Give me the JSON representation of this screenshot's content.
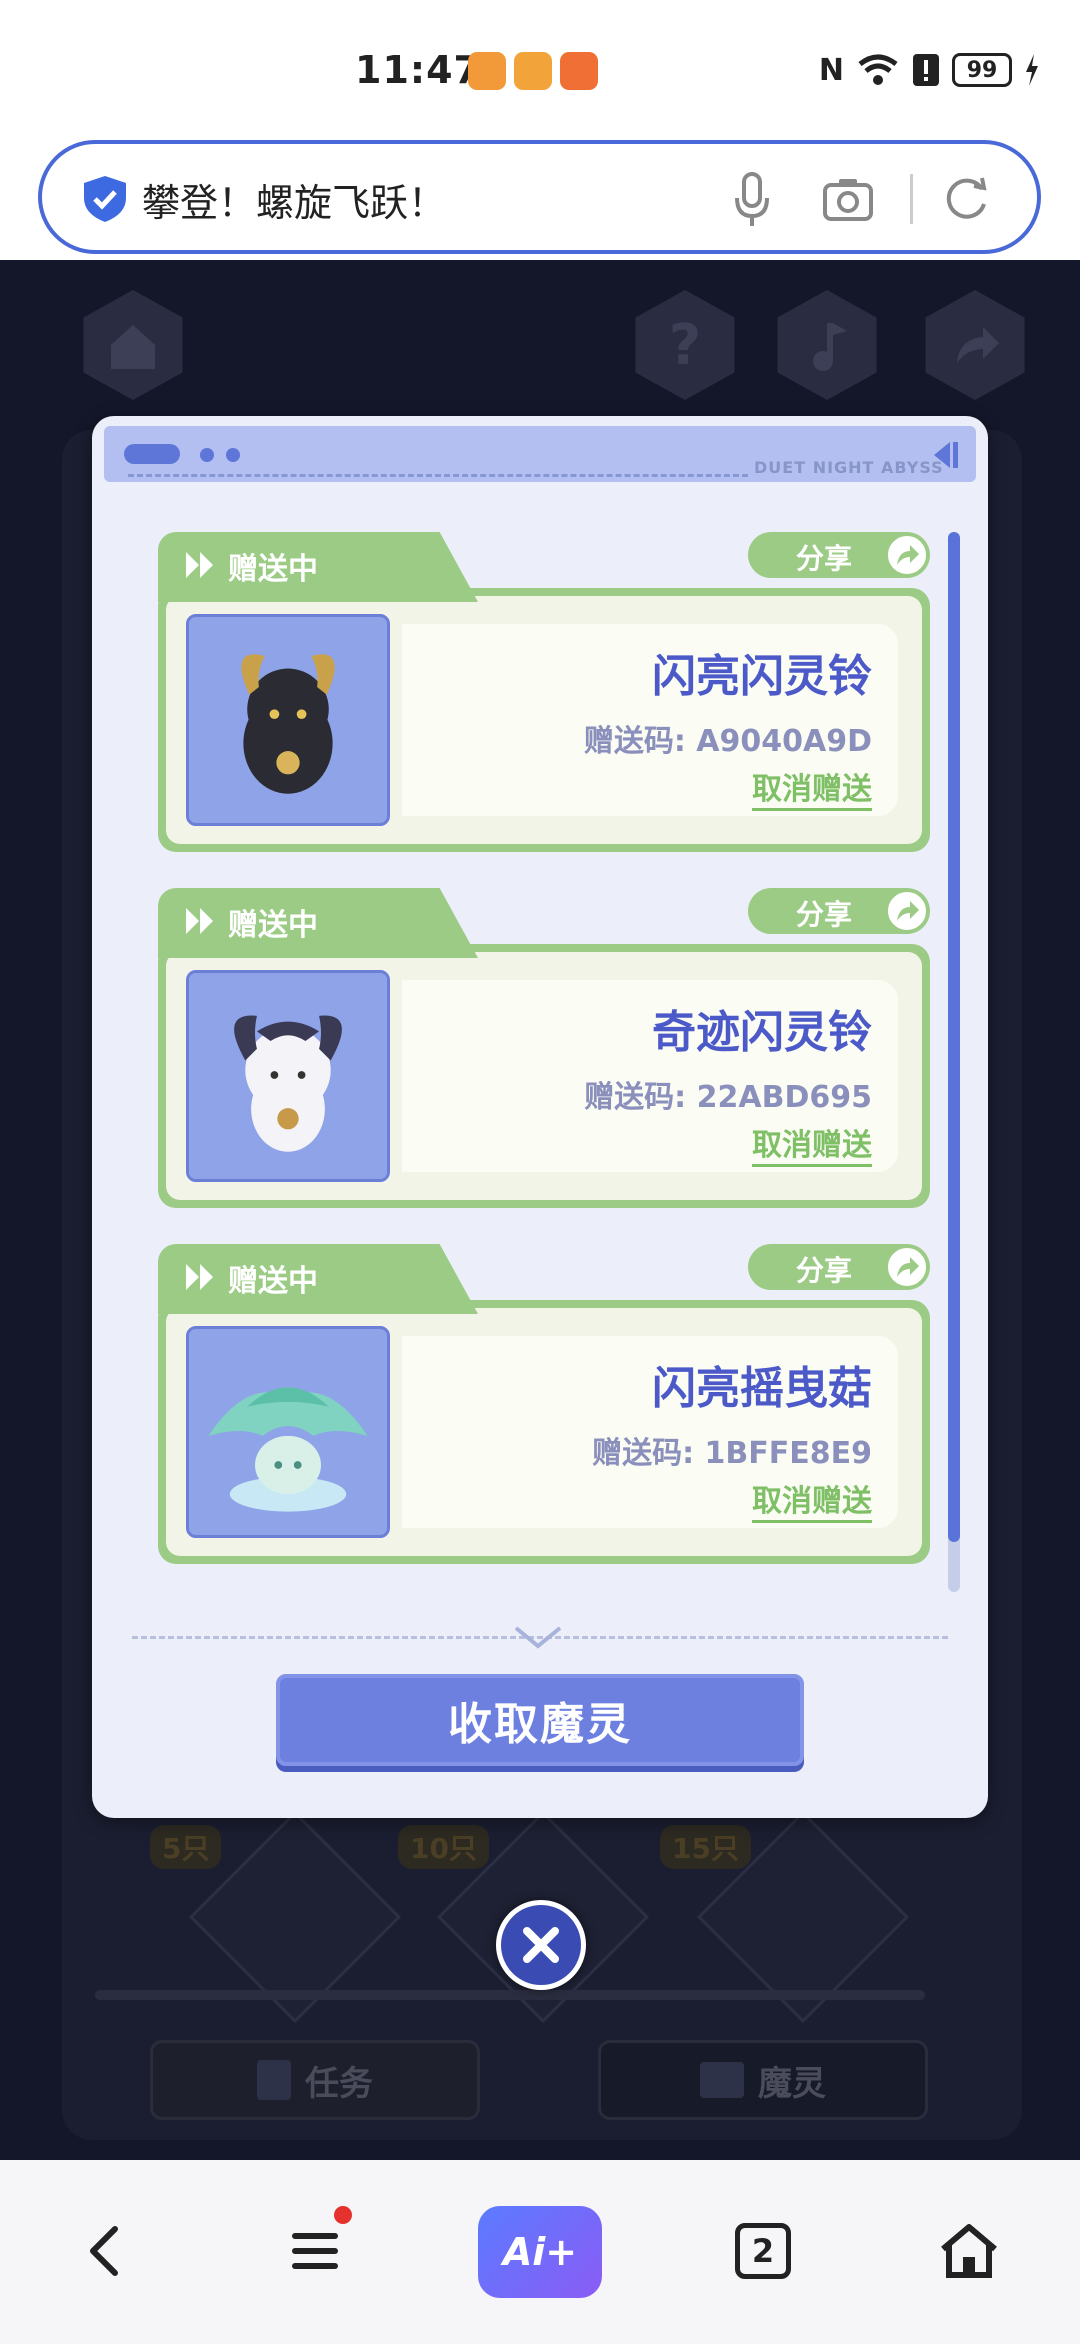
{
  "status_bar": {
    "time": "11:47",
    "battery": "99",
    "icons": [
      "nfc-icon",
      "wifi-icon",
      "alert-icon",
      "battery-icon",
      "charging-icon"
    ]
  },
  "search": {
    "query": "攀登！螺旋飞跃！",
    "icons": [
      "shield-icon",
      "mic-icon",
      "camera-icon",
      "reload-icon"
    ]
  },
  "modal": {
    "header_label": "DUET NIGHT ABYSS",
    "cards": [
      {
        "status": "赠送中",
        "share": "分享",
        "name": "闪亮闪灵铃",
        "code": "赠送码: A9040A9D",
        "cancel": "取消赠送"
      },
      {
        "status": "赠送中",
        "share": "分享",
        "name": "奇迹闪灵铃",
        "code": "赠送码: 22ABD695",
        "cancel": "取消赠送"
      },
      {
        "status": "赠送中",
        "share": "分享",
        "name": "闪亮摇曳菇",
        "code": "赠送码: 1BFFE8E9",
        "cancel": "取消赠送"
      }
    ],
    "collect_label": "收取魔灵"
  },
  "game": {
    "milestones": [
      "5只",
      "10只",
      "15只"
    ],
    "tabs": [
      "任务",
      "魔灵"
    ]
  },
  "bottom_nav": {
    "tabs_count": "2",
    "ai_label": "Ai+"
  },
  "colors": {
    "accent_blue": "#4a69d8",
    "card_green": "#9ccb86",
    "name_blue": "#4b5ac8",
    "button_blue": "#6d80e0"
  }
}
